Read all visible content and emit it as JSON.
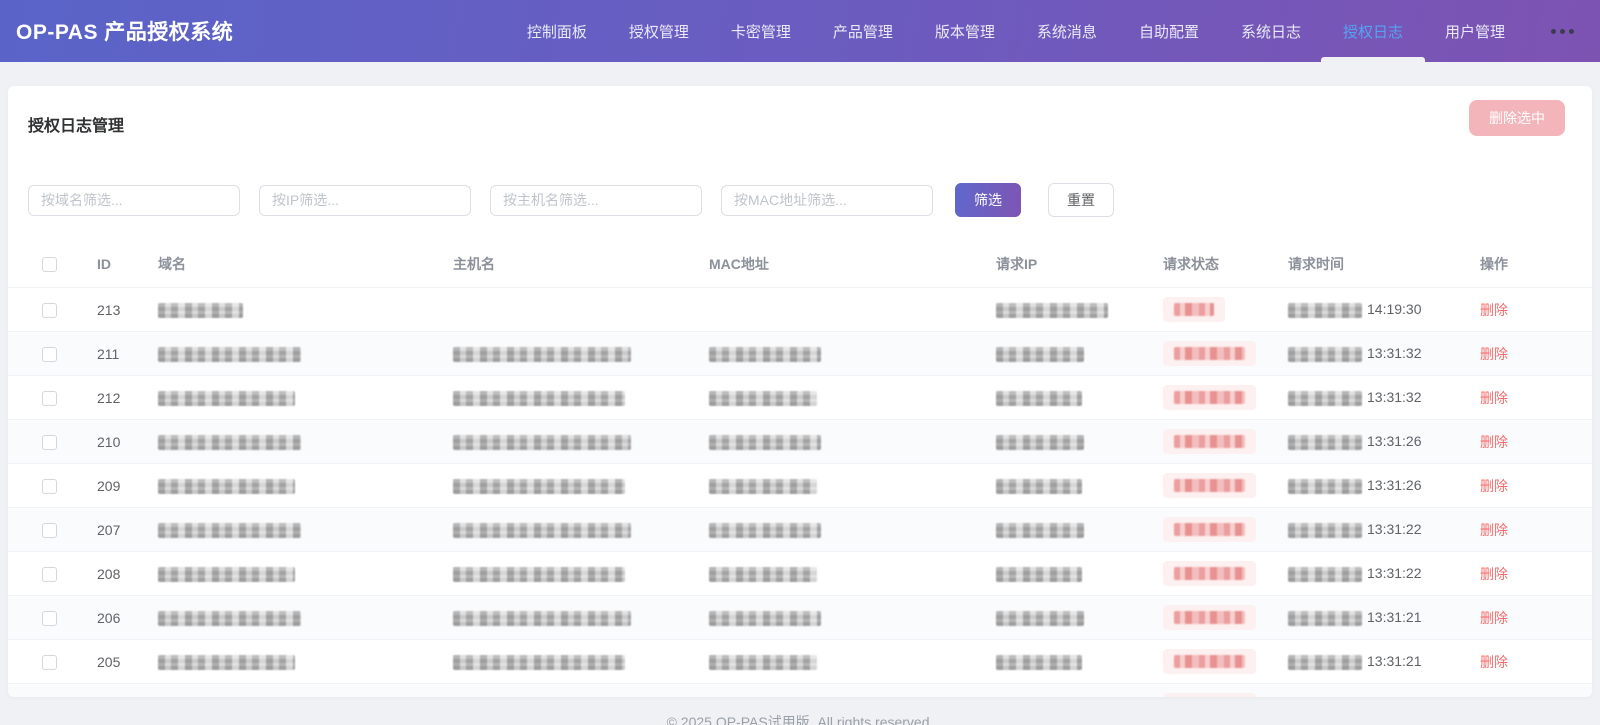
{
  "app": {
    "title": "OP-PAS 产品授权系统"
  },
  "nav": {
    "items": [
      {
        "label": "控制面板"
      },
      {
        "label": "授权管理"
      },
      {
        "label": "卡密管理"
      },
      {
        "label": "产品管理"
      },
      {
        "label": "版本管理"
      },
      {
        "label": "系统消息"
      },
      {
        "label": "自助配置"
      },
      {
        "label": "系统日志"
      },
      {
        "label": "授权日志"
      },
      {
        "label": "用户管理"
      }
    ],
    "active_index": 8,
    "more_icon": "ellipsis-icon"
  },
  "page": {
    "title": "授权日志管理",
    "delete_selected_label": "删除选中"
  },
  "filters": {
    "domain_placeholder": "按域名筛选...",
    "ip_placeholder": "按IP筛选...",
    "hostname_placeholder": "按主机名筛选...",
    "mac_placeholder": "按MAC地址筛选...",
    "filter_label": "筛选",
    "reset_label": "重置"
  },
  "table": {
    "columns": [
      "ID",
      "域名",
      "主机名",
      "MAC地址",
      "请求IP",
      "请求状态",
      "请求时间",
      "操作"
    ],
    "action_label": "删除",
    "rows": [
      {
        "id": "213",
        "time": "14:19:30",
        "redacted": {
          "domain": 85,
          "hostname": 0,
          "mac": 0,
          "ip": 112,
          "status": 40,
          "date": 74
        }
      },
      {
        "id": "211",
        "time": "13:31:32",
        "redacted": {
          "domain": 143,
          "hostname": 178,
          "mac": 112,
          "ip": 88,
          "status": 71,
          "date": 74
        }
      },
      {
        "id": "212",
        "time": "13:31:32",
        "redacted": {
          "domain": 137,
          "hostname": 172,
          "mac": 108,
          "ip": 86,
          "status": 71,
          "date": 74
        }
      },
      {
        "id": "210",
        "time": "13:31:26",
        "redacted": {
          "domain": 143,
          "hostname": 178,
          "mac": 112,
          "ip": 88,
          "status": 71,
          "date": 74
        }
      },
      {
        "id": "209",
        "time": "13:31:26",
        "redacted": {
          "domain": 137,
          "hostname": 172,
          "mac": 108,
          "ip": 86,
          "status": 71,
          "date": 74
        }
      },
      {
        "id": "207",
        "time": "13:31:22",
        "redacted": {
          "domain": 143,
          "hostname": 178,
          "mac": 112,
          "ip": 88,
          "status": 71,
          "date": 74
        }
      },
      {
        "id": "208",
        "time": "13:31:22",
        "redacted": {
          "domain": 137,
          "hostname": 172,
          "mac": 108,
          "ip": 86,
          "status": 71,
          "date": 74
        }
      },
      {
        "id": "206",
        "time": "13:31:21",
        "redacted": {
          "domain": 143,
          "hostname": 178,
          "mac": 112,
          "ip": 88,
          "status": 71,
          "date": 74
        }
      },
      {
        "id": "205",
        "time": "13:31:21",
        "redacted": {
          "domain": 137,
          "hostname": 172,
          "mac": 108,
          "ip": 86,
          "status": 71,
          "date": 74
        }
      },
      {
        "id": "",
        "time": "",
        "partial": true,
        "redacted": {
          "domain": 137,
          "hostname": 172,
          "mac": 108,
          "ip": 86,
          "status": 71,
          "date": 74
        }
      }
    ]
  },
  "footer": {
    "copyright": "© 2025 OP-PAS试用版. All rights reserved."
  },
  "colors": {
    "header_gradient_start": "#5a64c8",
    "header_gradient_end": "#7d53b2",
    "active_nav": "#57a3f3",
    "primary_button_gradient_start": "#5f68cc",
    "primary_button_gradient_end": "#7e55b4",
    "danger": "#f56c6c",
    "danger_disabled": "#f3b5ba",
    "status_badge_bg": "#fdf0f0",
    "page_bg": "#f0f1f5"
  }
}
